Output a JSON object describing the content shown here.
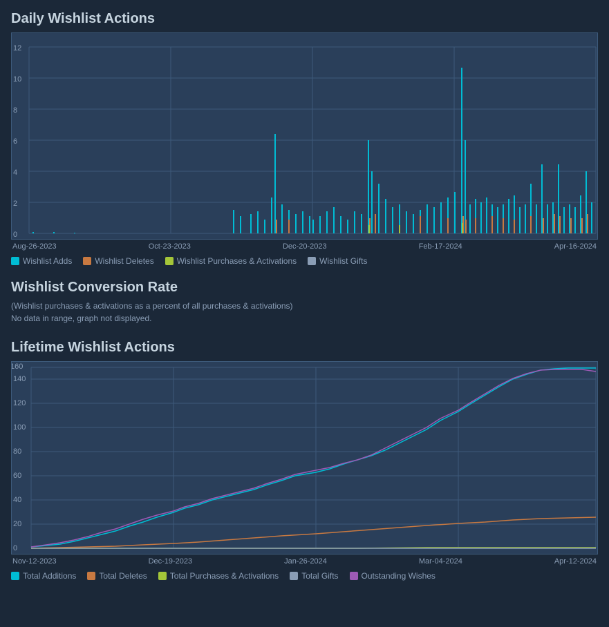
{
  "daily_chart": {
    "title": "Daily Wishlist Actions",
    "x_labels": [
      "Aug-26-2023",
      "Oct-23-2023",
      "Dec-20-2023",
      "Feb-17-2024",
      "Apr-16-2024"
    ],
    "y_labels": [
      "0",
      "2",
      "4",
      "6",
      "8",
      "10",
      "12"
    ],
    "legend": [
      {
        "label": "Wishlist Adds",
        "color": "#00bcd4"
      },
      {
        "label": "Wishlist Deletes",
        "color": "#c87941"
      },
      {
        "label": "Wishlist Purchases & Activations",
        "color": "#a4c639"
      },
      {
        "label": "Wishlist Gifts",
        "color": "#8a9db5"
      }
    ]
  },
  "conversion_chart": {
    "title": "Wishlist Conversion Rate",
    "subtitle": "(Wishlist purchases & activations as a percent of all purchases & activations)",
    "no_data_text": "No data in range, graph not displayed."
  },
  "lifetime_chart": {
    "title": "Lifetime Wishlist Actions",
    "x_labels": [
      "Nov-12-2023",
      "Dec-19-2023",
      "Jan-26-2024",
      "Mar-04-2024",
      "Apr-12-2024"
    ],
    "y_labels": [
      "0",
      "20",
      "40",
      "60",
      "80",
      "100",
      "120",
      "140",
      "160"
    ],
    "legend": [
      {
        "label": "Total Additions",
        "color": "#00bcd4"
      },
      {
        "label": "Total Deletes",
        "color": "#c87941"
      },
      {
        "label": "Total Purchases & Activations",
        "color": "#a4c639"
      },
      {
        "label": "Total Gifts",
        "color": "#8a9db5"
      },
      {
        "label": "Outstanding Wishes",
        "color": "#9c5ab5"
      }
    ]
  }
}
